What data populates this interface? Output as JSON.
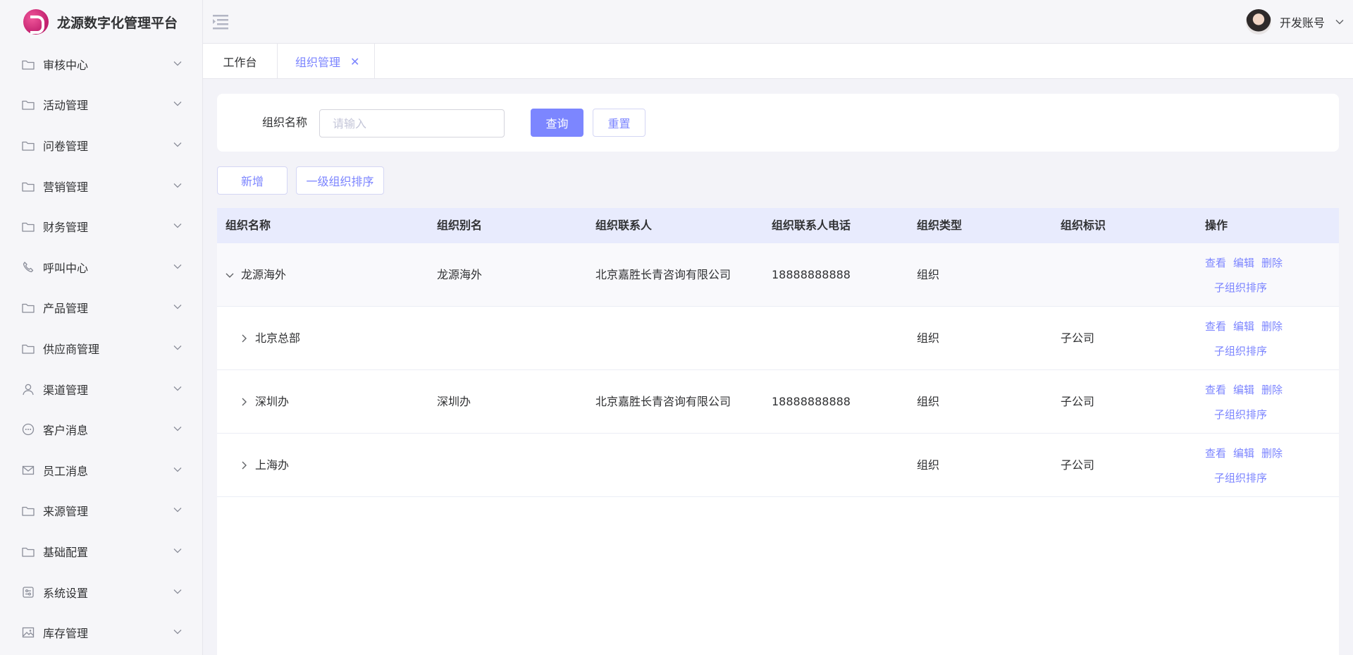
{
  "app": {
    "title": "龙源数字化管理平台"
  },
  "sidebar": {
    "items": [
      {
        "label": "审核中心",
        "icon": "folder-icon"
      },
      {
        "label": "活动管理",
        "icon": "folder-icon"
      },
      {
        "label": "问卷管理",
        "icon": "folder-icon"
      },
      {
        "label": "营销管理",
        "icon": "folder-icon"
      },
      {
        "label": "财务管理",
        "icon": "folder-icon"
      },
      {
        "label": "呼叫中心",
        "icon": "phone-icon"
      },
      {
        "label": "产品管理",
        "icon": "folder-icon"
      },
      {
        "label": "供应商管理",
        "icon": "folder-icon"
      },
      {
        "label": "渠道管理",
        "icon": "user-icon"
      },
      {
        "label": "客户消息",
        "icon": "chat-icon"
      },
      {
        "label": "员工消息",
        "icon": "mail-icon"
      },
      {
        "label": "来源管理",
        "icon": "folder-icon"
      },
      {
        "label": "基础配置",
        "icon": "folder-icon"
      },
      {
        "label": "系统设置",
        "icon": "settings-icon"
      },
      {
        "label": "库存管理",
        "icon": "picture-icon"
      }
    ]
  },
  "header": {
    "username": "开发账号"
  },
  "tabs": [
    {
      "label": "工作台"
    },
    {
      "label": "组织管理",
      "closable": true
    }
  ],
  "search": {
    "label": "组织名称",
    "placeholder": "请输入",
    "query_label": "查询",
    "reset_label": "重置"
  },
  "toolbar": {
    "add_label": "新增",
    "sort_label": "一级组织排序"
  },
  "table": {
    "columns": [
      "组织名称",
      "组织别名",
      "组织联系人",
      "组织联系人电话",
      "组织类型",
      "组织标识",
      "操作"
    ],
    "rows": [
      {
        "name": "龙源海外",
        "alias": "龙源海外",
        "contact": "北京嘉胜长青咨询有限公司",
        "phone": "18888888888",
        "type": "组织",
        "tag": "",
        "expanded": true
      },
      {
        "name": "北京总部",
        "alias": "",
        "contact": "",
        "phone": "",
        "type": "组织",
        "tag": "子公司",
        "expanded": false
      },
      {
        "name": "深圳办",
        "alias": "深圳办",
        "contact": "北京嘉胜长青咨询有限公司",
        "phone": "18888888888",
        "type": "组织",
        "tag": "子公司",
        "expanded": false
      },
      {
        "name": "上海办",
        "alias": "",
        "contact": "",
        "phone": "",
        "type": "组织",
        "tag": "子公司",
        "expanded": false
      }
    ],
    "actions": {
      "view": "查看",
      "edit": "编辑",
      "delete": "删除",
      "sub_sort": "子组织排序"
    }
  },
  "colors": {
    "accent": "#7c86ff",
    "header_bg": "#e8ebfd"
  }
}
